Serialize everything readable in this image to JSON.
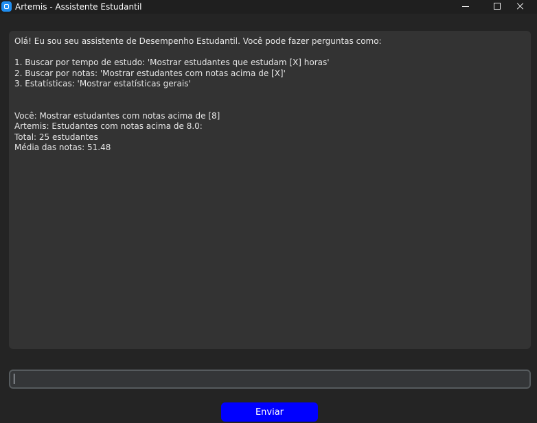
{
  "window": {
    "title": "Artemis - Assistente Estudantil",
    "icon": "app-icon"
  },
  "chat": {
    "lines": [
      "Olá! Eu sou seu assistente de Desempenho Estudantil. Você pode fazer perguntas como:",
      "",
      "1. Buscar por tempo de estudo: 'Mostrar estudantes que estudam [X] horas'",
      "2. Buscar por notas: 'Mostrar estudantes com notas acima de [X]'",
      "3. Estatísticas: 'Mostrar estatísticas gerais'",
      "",
      "",
      "Você: Mostrar estudantes com notas acima de [8]",
      "Artemis: Estudantes com notas acima de 8.0:",
      "Total: 25 estudantes",
      "Média das notas: 51.48"
    ]
  },
  "input": {
    "value": "",
    "placeholder": ""
  },
  "send_button": {
    "label": "Enviar",
    "color": "#0000ff"
  },
  "colors": {
    "background": "#242424",
    "chat_background": "#333333",
    "input_border": "#565b5e"
  }
}
